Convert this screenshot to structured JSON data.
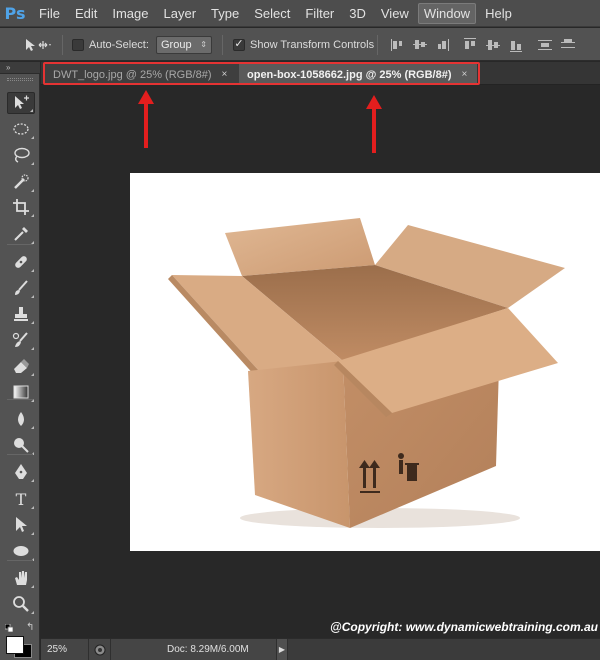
{
  "app": {
    "logo": "Ps"
  },
  "menu": [
    "File",
    "Edit",
    "Image",
    "Layer",
    "Type",
    "Select",
    "Filter",
    "3D",
    "View",
    "Window",
    "Help"
  ],
  "menu_active": "Window",
  "options": {
    "auto_select_label": "Auto-Select:",
    "auto_select_checked": false,
    "auto_select_value": "Group",
    "show_transform_label": "Show Transform Controls",
    "show_transform_checked": true
  },
  "panel_toggle": "»",
  "tabs": [
    {
      "label": "DWT_logo.jpg @ 25% (RGB/8#)",
      "active": false,
      "close": "×"
    },
    {
      "label": "open-box-1058662.jpg @ 25% (RGB/8#)",
      "active": true,
      "close": "×"
    }
  ],
  "tools": [
    "move-tool",
    "marquee-tool",
    "lasso-tool",
    "quick-selection-tool",
    "crop-tool",
    "eyedropper-tool",
    "healing-brush-tool",
    "brush-tool",
    "clone-stamp-tool",
    "history-brush-tool",
    "eraser-tool",
    "gradient-tool",
    "blur-tool",
    "dodge-tool",
    "pen-tool",
    "type-tool",
    "path-selection-tool",
    "ellipse-tool",
    "hand-tool",
    "zoom-tool"
  ],
  "type_tool_glyph": "T",
  "colors": {
    "foreground": "#ffffff",
    "background": "#000000",
    "annotation": "#e53333",
    "box": "#c89a73"
  },
  "swap_glyph": "↰",
  "copyright": "@Copyright: www.dynamicwebtraining.com.au",
  "status": {
    "zoom": "25%",
    "doc": "Doc: 8.29M/6.00M",
    "arrow": "▶"
  }
}
